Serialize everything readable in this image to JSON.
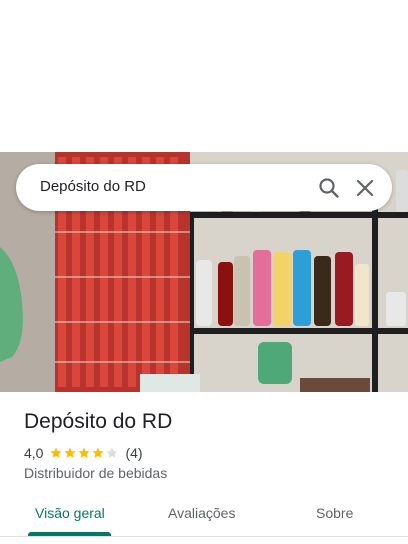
{
  "search": {
    "query": "Depósito do RD"
  },
  "place": {
    "name": "Depósito do RD",
    "rating": "4,0",
    "stars": 4,
    "review_count": "(4)",
    "category": "Distribuidor de bebidas"
  },
  "tabs": [
    {
      "label": "Visão geral",
      "active": true
    },
    {
      "label": "Avaliações",
      "active": false
    },
    {
      "label": "Sobre",
      "active": false
    }
  ],
  "colors": {
    "accent": "#00796b",
    "star": "#fbbc04",
    "star_empty": "#dadce0"
  },
  "icons": {
    "search": "search-icon",
    "close": "close-icon"
  }
}
